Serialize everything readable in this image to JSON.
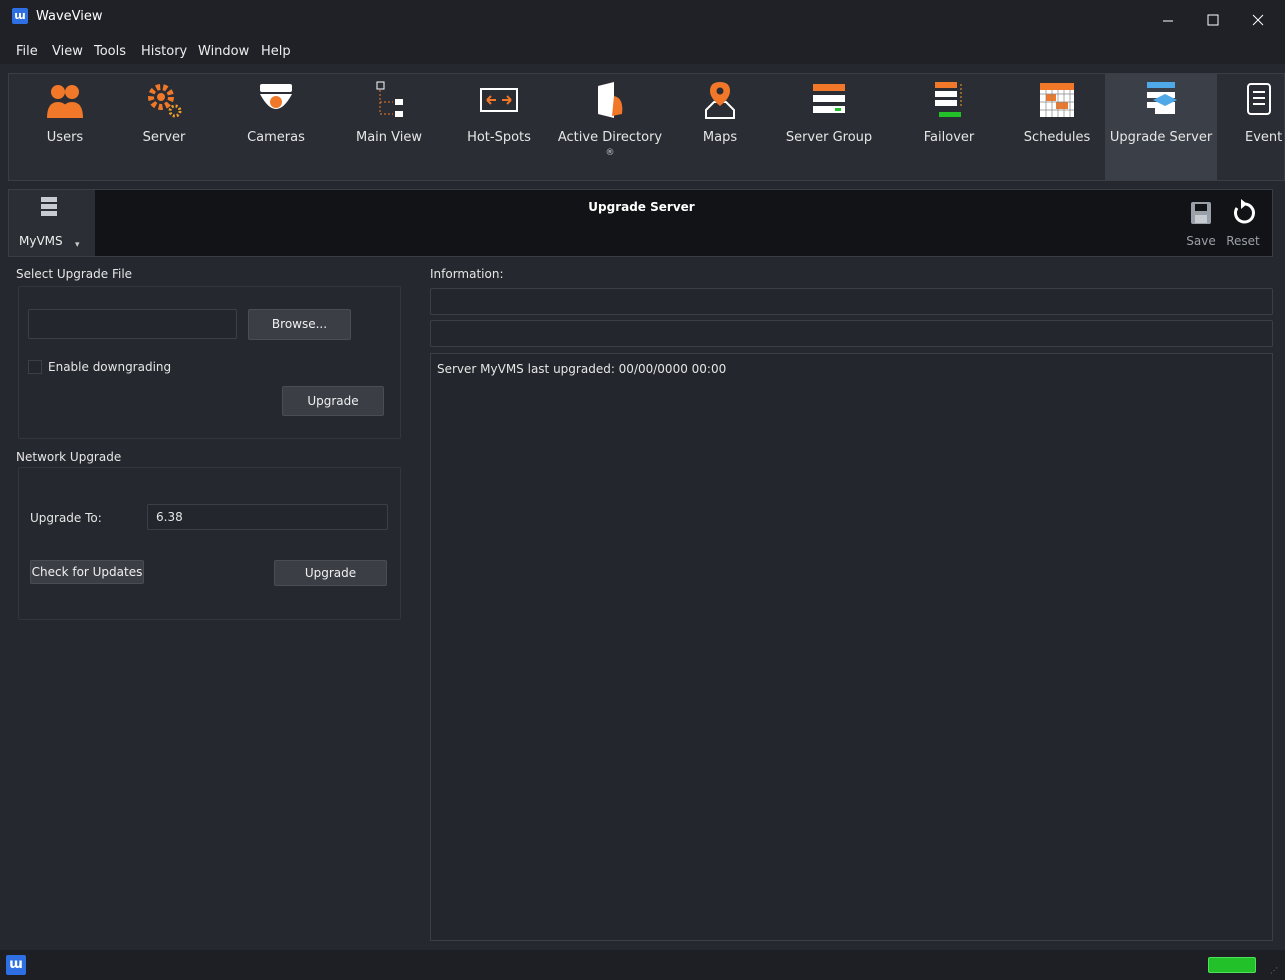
{
  "window": {
    "title": "WaveView",
    "logo_letter": "ɯ"
  },
  "menu": [
    {
      "label": "File"
    },
    {
      "label": "View"
    },
    {
      "label": "Tools"
    },
    {
      "label": "History"
    },
    {
      "label": "Window"
    },
    {
      "label": "Help"
    }
  ],
  "toolbar": [
    {
      "label": "Users",
      "icon": "users-icon"
    },
    {
      "label": "Server",
      "icon": "server-gear-icon"
    },
    {
      "label": "Cameras",
      "icon": "dome-camera-icon"
    },
    {
      "label": "Main View",
      "icon": "main-view-tree-icon"
    },
    {
      "label": "Hot-Spots",
      "icon": "hot-spots-icon"
    },
    {
      "label": "Active Directory",
      "icon": "active-directory-icon",
      "sub": "®"
    },
    {
      "label": "Maps",
      "icon": "map-pin-icon"
    },
    {
      "label": "Server Group",
      "icon": "server-group-icon"
    },
    {
      "label": "Failover",
      "icon": "failover-icon"
    },
    {
      "label": "Schedules",
      "icon": "schedule-grid-icon"
    },
    {
      "label": "Upgrade Server",
      "icon": "upgrade-server-icon"
    },
    {
      "label": "Event l",
      "icon": "event-log-icon"
    }
  ],
  "header": {
    "title": "Upgrade Server",
    "server": "MyVMS",
    "save_label": "Save",
    "reset_label": "Reset"
  },
  "upgrade_file": {
    "section_label": "Select Upgrade File",
    "file_value": "",
    "browse_label": "Browse...",
    "downgrade_label": "Enable downgrading",
    "upgrade_label": "Upgrade"
  },
  "network": {
    "section_label": "Network Upgrade",
    "upgrade_to_label": "Upgrade To:",
    "upgrade_to_value": "6.38",
    "check_label": "Check for Updates",
    "upgrade_label": "Upgrade"
  },
  "information": {
    "label": "Information:",
    "bar1": "",
    "bar2": "",
    "message": "Server MyVMS last upgraded: 00/00/0000 00:00"
  },
  "status": {
    "logo_letter": "ɯ",
    "led_color": "#22c12a"
  },
  "colors": {
    "accent_orange": "#f07828",
    "brand_blue": "#2f6fe4",
    "active_tab": "#3b3f47"
  }
}
